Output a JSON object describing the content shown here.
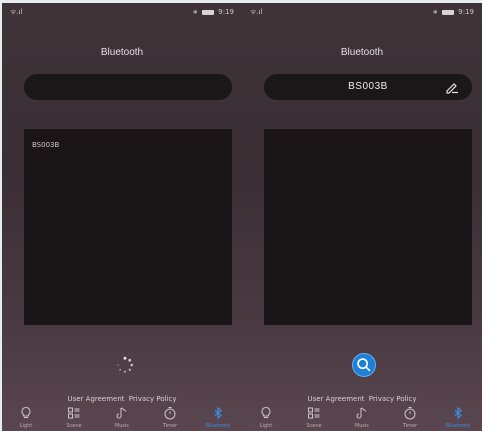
{
  "left_screen": {
    "status": {
      "signal": "ᯤ.ıl",
      "bluetooth": "∗",
      "time": "9:19"
    },
    "title": "Bluetooth",
    "device_name": "",
    "devices": [
      "BS003B"
    ],
    "state": "searching",
    "links": {
      "user_agreement": "User Agreement",
      "privacy_policy": "Privacy Policy"
    },
    "tabs": [
      {
        "label": "Light",
        "icon": "bulb-icon",
        "active": false
      },
      {
        "label": "Scene",
        "icon": "scene-grid-icon",
        "active": false
      },
      {
        "label": "Music",
        "icon": "music-note-icon",
        "active": false
      },
      {
        "label": "Timer",
        "icon": "timer-icon",
        "active": false
      },
      {
        "label": "Bluetooth",
        "icon": "bluetooth-icon",
        "active": true
      }
    ]
  },
  "right_screen": {
    "status": {
      "signal": "ᯤ.ıl",
      "bluetooth": "∗",
      "time": "9:19"
    },
    "title": "Bluetooth",
    "device_name": "BS003B",
    "devices": [],
    "state": "idle",
    "links": {
      "user_agreement": "User Agreement",
      "privacy_policy": "Privacy Policy"
    },
    "tabs": [
      {
        "label": "Light",
        "icon": "bulb-icon",
        "active": false
      },
      {
        "label": "Scene",
        "icon": "scene-grid-icon",
        "active": false
      },
      {
        "label": "Music",
        "icon": "music-note-icon",
        "active": false
      },
      {
        "label": "Timer",
        "icon": "timer-icon",
        "active": false
      },
      {
        "label": "Bluetooth",
        "icon": "bluetooth-icon",
        "active": true
      }
    ]
  },
  "colors": {
    "accent": "#3a8fe0",
    "background": "#3e3438",
    "box": "#1a1517"
  }
}
